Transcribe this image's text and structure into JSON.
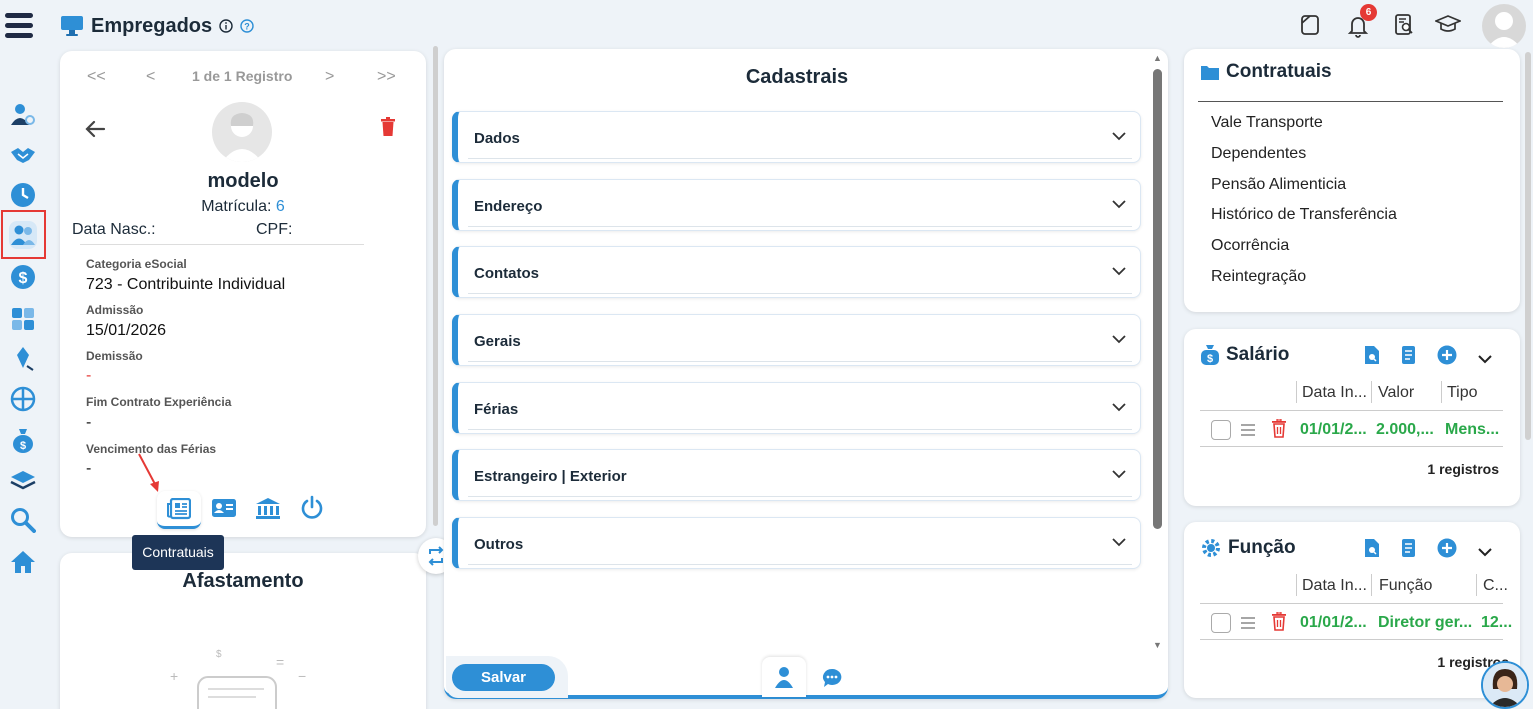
{
  "header": {
    "title": "Empregados",
    "notif_count": "6"
  },
  "nav_rail": {
    "items": [
      "users-settings-icon",
      "handshake-icon",
      "clock-icon",
      "people-icon",
      "dollar-icon",
      "calculator-icon",
      "pen-icon",
      "network-icon",
      "money-bag-icon",
      "layers-icon",
      "search-icon",
      "home-icon"
    ]
  },
  "employee": {
    "pager": {
      "first": "<<",
      "prev": "<",
      "text": "1 de 1 Registro",
      "next": ">",
      "last": ">>"
    },
    "name": "modelo",
    "matricula_label": "Matrícula:",
    "matricula": "6",
    "dob_label": "Data Nasc.:",
    "cpf_label": "CPF:",
    "fields": [
      {
        "label": "Categoria eSocial",
        "value": "723 - Contribuinte Individual"
      },
      {
        "label": "Admissão",
        "value": "15/01/2026"
      },
      {
        "label": "Demissão",
        "value": "-"
      },
      {
        "label": "Fim Contrato Experiência",
        "value": "-"
      },
      {
        "label": "Vencimento das Férias",
        "value": "-"
      }
    ],
    "tooltip": "Contratuais"
  },
  "afastamento": {
    "title": "Afastamento"
  },
  "cadastrais": {
    "title": "Cadastrais",
    "sections": [
      "Dados",
      "Endereço",
      "Contatos",
      "Gerais",
      "Férias",
      "Estrangeiro | Exterior",
      "Outros"
    ],
    "save_label": "Salvar"
  },
  "contratuais": {
    "title": "Contratuais",
    "links": [
      "Vale Transporte",
      "Dependentes",
      "Pensão Alimenticia",
      "Histórico de Transferência",
      "Ocorrência",
      "Reintegração"
    ]
  },
  "salario": {
    "title": "Salário",
    "columns": [
      "Data In...",
      "Valor",
      "Tipo"
    ],
    "rows": [
      {
        "date": "01/01/2...",
        "valor": "2.000,...",
        "tipo": "Mens..."
      }
    ],
    "count": "1 registros"
  },
  "funcao": {
    "title": "Função",
    "columns": [
      "Data In...",
      "Função",
      "C..."
    ],
    "rows": [
      {
        "date": "01/01/2...",
        "funcao": "Diretor ger...",
        "c": "12..."
      }
    ],
    "count": "1 registros"
  },
  "colors": {
    "accent": "#2e8fd6",
    "brand": "#1c2b39",
    "danger": "#e53935",
    "success": "#2aa84a"
  }
}
